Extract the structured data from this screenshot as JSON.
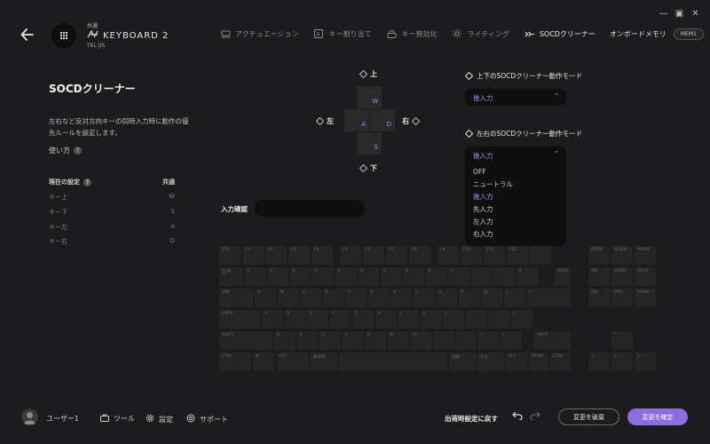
{
  "header": {
    "profile_top": "共通",
    "keyboard_name": "KEYBOARD 2",
    "keyboard_sub": "TKL JIS"
  },
  "tabs": [
    {
      "label": "アクチュエーション",
      "icon": "actuation-icon"
    },
    {
      "label": "キー割り当て",
      "icon": "key-assign-icon"
    },
    {
      "label": "キー無効化",
      "icon": "lock-icon"
    },
    {
      "label": "ライティング",
      "icon": "sun-icon"
    },
    {
      "label": "SOCDクリーナー",
      "icon": "socd-icon",
      "active": true
    },
    {
      "label": "オンボードメモリ"
    },
    {
      "label": "MEM1",
      "memory": true
    }
  ],
  "left": {
    "title": "SOCDクリーナー",
    "description": "左右など反対方向キーの同時入力時に動作の優先ルールを設定します。",
    "howto": "使い方",
    "current_label": "現在の設定",
    "current_profile": "共通",
    "rows": [
      {
        "label": "キー上",
        "value": "W"
      },
      {
        "label": "キー下",
        "value": "S"
      },
      {
        "label": "キー左",
        "value": "A"
      },
      {
        "label": "キー右",
        "value": "D"
      }
    ]
  },
  "wasd": {
    "up": "上",
    "down": "下",
    "left": "左",
    "right": "右",
    "keys": {
      "w": "W",
      "a": "A",
      "s": "S",
      "d": "D"
    }
  },
  "modes": {
    "vertical_label": "上下のSOCDクリーナー動作モード",
    "vertical_value": "後入力",
    "horizontal_label": "左右のSOCDクリーナー動作モード",
    "horizontal_value": "後入力",
    "options": [
      "OFF",
      "ニュートラル",
      "後入力",
      "先入力",
      "左入力",
      "右入力"
    ],
    "selected_index": 2
  },
  "input_check": {
    "label": "入力確認"
  },
  "keyboard": {
    "row0": [
      "ESC",
      "F1",
      "F2",
      "F3",
      "F4",
      "F5",
      "F6",
      "F7",
      "F8",
      "F9",
      "F10",
      "F11",
      "F12",
      ""
    ],
    "row1": [
      "全/半",
      "1",
      "2",
      "3",
      "4",
      "5",
      "6",
      "7",
      "8",
      "9",
      "0",
      "-",
      "^",
      "¥",
      "BACK"
    ],
    "row2": [
      "TAB",
      "Q",
      "W",
      "E",
      "R",
      "T",
      "Y",
      "U",
      "I",
      "O",
      "P",
      "@",
      "[",
      "↵"
    ],
    "row3": [
      "CAPS",
      "A",
      "S",
      "D",
      "F",
      "G",
      "H",
      "J",
      "K",
      "L",
      ";",
      ":",
      "]"
    ],
    "row4": [
      "SHIFT",
      "Z",
      "X",
      "C",
      "V",
      "B",
      "N",
      "M",
      ",",
      ".",
      "/",
      "\\",
      "SHIFT"
    ],
    "row5": [
      "CTRL",
      "⊞",
      "ALT",
      "無変換",
      "",
      "変換",
      "かな",
      "ALT",
      "MENU",
      "CTRL"
    ],
    "nav1": [
      "PRTSC",
      "SCRLK",
      "PAUSE"
    ],
    "nav2": [
      "INS",
      "HOME",
      "PGUP"
    ],
    "nav3": [
      "DEL",
      "END",
      "PGDN"
    ],
    "arrows": [
      "^",
      "<",
      "v",
      ">"
    ]
  },
  "footer": {
    "user": "ユーザー1",
    "tools": "ツール",
    "settings": "設定",
    "support": "サポート",
    "reset": "出荷時設定に戻す",
    "discard": "変更を破棄",
    "apply": "変更を確定"
  },
  "colors": {
    "accent": "#8c6ee0",
    "accent_text": "#a48ff0",
    "background": "#1c1c1e"
  }
}
